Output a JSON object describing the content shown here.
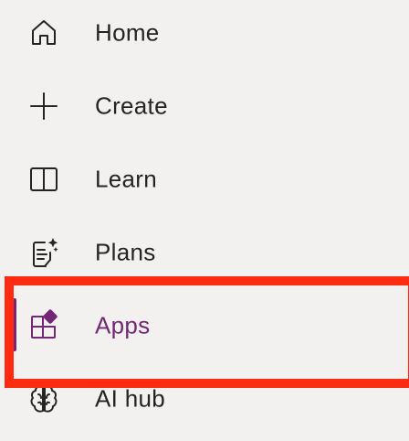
{
  "nav": {
    "items": [
      {
        "id": "home",
        "label": "Home",
        "icon": "home-icon",
        "active": false
      },
      {
        "id": "create",
        "label": "Create",
        "icon": "plus-icon",
        "active": false
      },
      {
        "id": "learn",
        "label": "Learn",
        "icon": "book-icon",
        "active": false
      },
      {
        "id": "plans",
        "label": "Plans",
        "icon": "plans-sparkle-icon",
        "active": false
      },
      {
        "id": "apps",
        "label": "Apps",
        "icon": "apps-icon",
        "active": true
      },
      {
        "id": "aihub",
        "label": "AI hub",
        "icon": "brain-icon",
        "active": false
      }
    ]
  },
  "colors": {
    "background": "#f3f1f0",
    "text": "#242424",
    "accent": "#742774",
    "highlight": "#ff2a12"
  }
}
